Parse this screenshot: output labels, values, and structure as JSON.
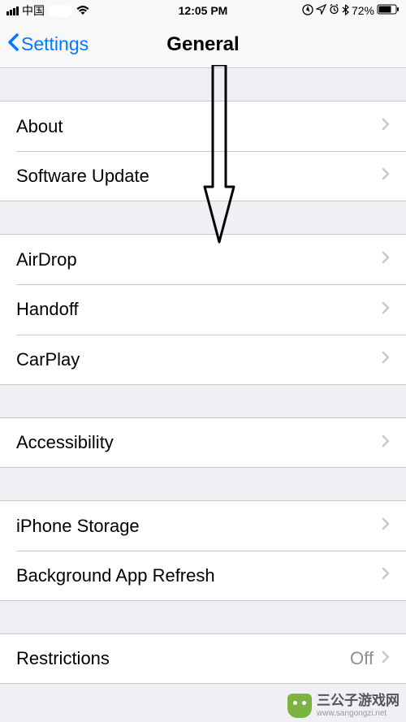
{
  "status": {
    "carrier": "中国",
    "time": "12:05 PM",
    "battery": "72%"
  },
  "nav": {
    "back": "Settings",
    "title": "General"
  },
  "groups": [
    {
      "items": [
        {
          "label": "About"
        },
        {
          "label": "Software Update"
        }
      ]
    },
    {
      "items": [
        {
          "label": "AirDrop"
        },
        {
          "label": "Handoff"
        },
        {
          "label": "CarPlay"
        }
      ]
    },
    {
      "items": [
        {
          "label": "Accessibility"
        }
      ]
    },
    {
      "items": [
        {
          "label": "iPhone Storage"
        },
        {
          "label": "Background App Refresh"
        }
      ]
    },
    {
      "items": [
        {
          "label": "Restrictions",
          "value": "Off"
        }
      ]
    }
  ],
  "watermark": {
    "text": "三公子游戏网",
    "sub": "www.sangongzi.net"
  }
}
